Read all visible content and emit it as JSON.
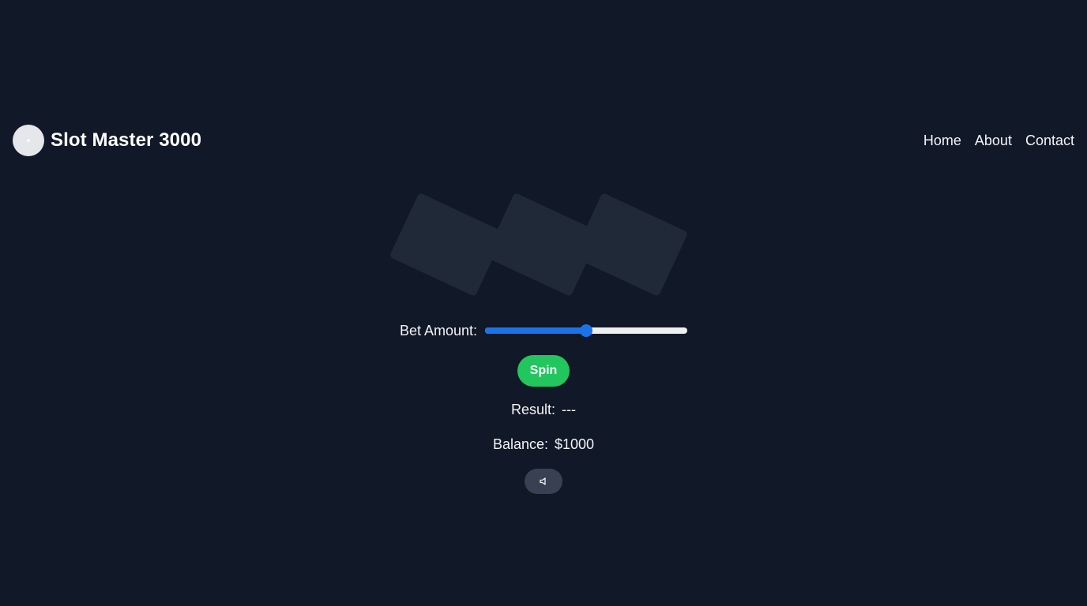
{
  "app": {
    "title": "Slot Master 3000"
  },
  "nav": {
    "items": [
      {
        "label": "Home"
      },
      {
        "label": "About"
      },
      {
        "label": "Contact"
      }
    ]
  },
  "reels": {
    "count": 3
  },
  "controls": {
    "bet_label": "Bet Amount:",
    "bet_slider_fraction": 0.5,
    "spin_label": "Spin",
    "sound_icon": "speaker-icon"
  },
  "status": {
    "result_label": "Result:",
    "result_value": "---",
    "balance_label": "Balance:",
    "balance_value": "$1000"
  },
  "colors": {
    "background": "#111827",
    "reel": "#1f2937",
    "spin_button": "#22c55e",
    "slider_accent": "#1a73e8",
    "sound_button": "#374151"
  }
}
